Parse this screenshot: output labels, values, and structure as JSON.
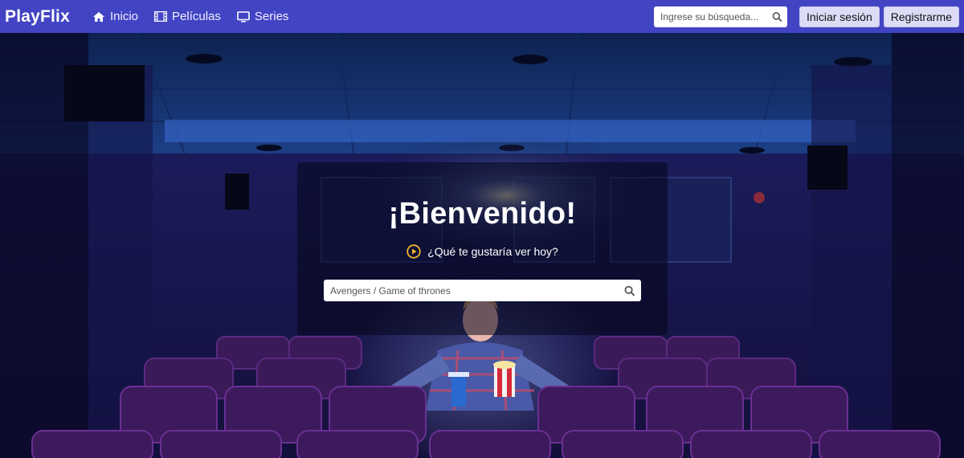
{
  "navbar": {
    "brand": "PlayFlix",
    "links": [
      {
        "label": "Inicio",
        "icon": "home-icon"
      },
      {
        "label": "Películas",
        "icon": "film-icon"
      },
      {
        "label": "Series",
        "icon": "tv-icon"
      }
    ],
    "search_placeholder": "Ingrese su búsqueda...",
    "login_label": "Iniciar sesión",
    "register_label": "Registrarme"
  },
  "hero": {
    "title": "¡Bienvenido!",
    "subtitle": "¿Qué te gustaría ver hoy?",
    "subtitle_icon": "play-circle-icon",
    "search_placeholder": "Avengers / Game of thrones",
    "background_image": "cinema-audience-photo"
  },
  "colors": {
    "navbar": "#4244c4",
    "accent_icon": "#f0b429",
    "button_bg": "#dcdcf6"
  }
}
